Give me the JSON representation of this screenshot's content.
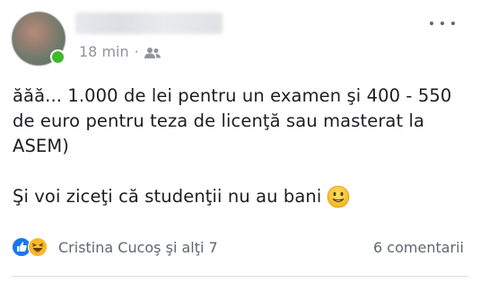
{
  "header": {
    "time": "18 min",
    "separator": "·",
    "privacy_icon": "friends-icon",
    "more_icon": "more-horizontal-icon"
  },
  "post": {
    "line1": "ăăă... 1.000 de lei pentru un examen şi 400 - 550 de euro pentru teza de licenţă sau masterat la ASEM)",
    "line2": "Şi voi ziceţi că studenţii nu au bani",
    "emoji": "grimacing-face-emoji"
  },
  "footer": {
    "reaction_icons": [
      "like-reaction-icon",
      "haha-reaction-icon"
    ],
    "reactors": "Cristina Cucoş şi alţi 7",
    "comments": "6 comentarii"
  },
  "colors": {
    "online": "#42b72a",
    "like_blue": "#1877f2",
    "haha_yellow": "#f7b928",
    "meta_gray": "#90949c"
  }
}
